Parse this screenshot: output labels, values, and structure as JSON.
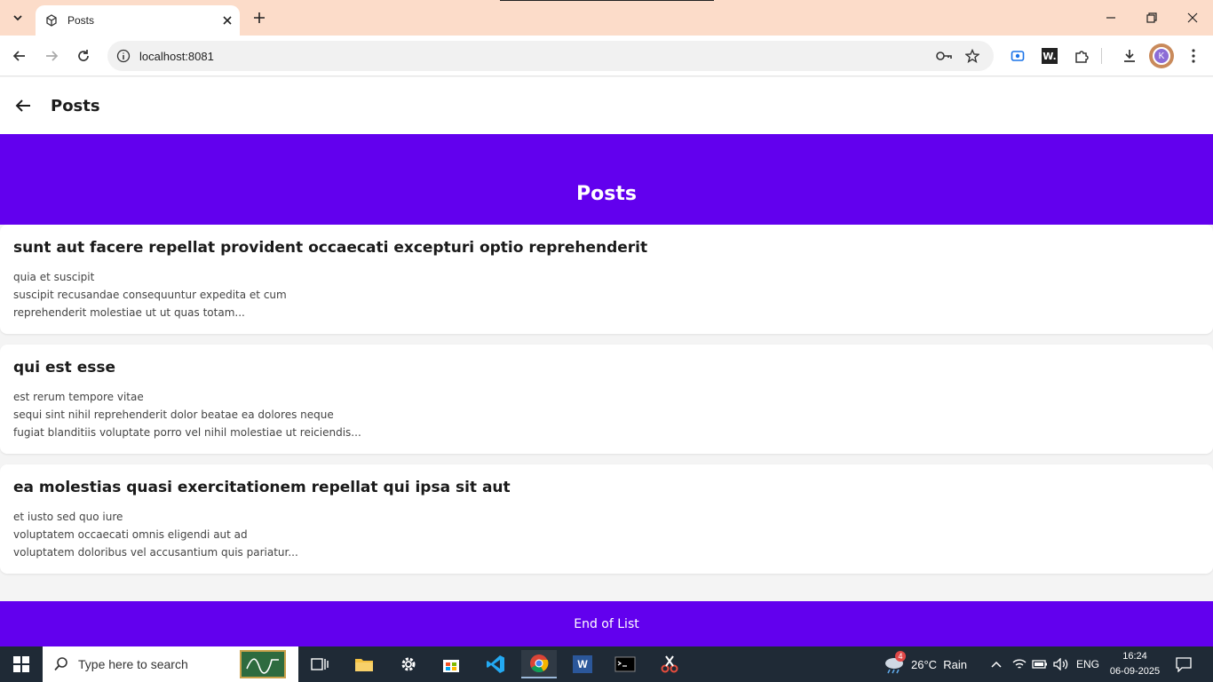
{
  "browser": {
    "tab_title": "Posts",
    "url": "localhost:8081",
    "avatar_letter": "K"
  },
  "app": {
    "header_title": "Posts",
    "hero_title": "Posts",
    "footer_text": "End of List",
    "accent_color": "#6200ee"
  },
  "posts": [
    {
      "title": "sunt aut facere repellat provident occaecati excepturi optio reprehenderit",
      "lines": [
        "quia et suscipit",
        "suscipit recusandae consequuntur expedita et cum",
        "reprehenderit molestiae ut ut quas totam..."
      ]
    },
    {
      "title": "qui est esse",
      "lines": [
        "est rerum tempore vitae",
        "sequi sint nihil reprehenderit dolor beatae ea dolores neque",
        "fugiat blanditiis voluptate porro vel nihil molestiae ut reiciendis..."
      ]
    },
    {
      "title": "ea molestias quasi exercitationem repellat qui ipsa sit aut",
      "lines": [
        "et iusto sed quo iure",
        "voluptatem occaecati omnis eligendi aut ad",
        "voluptatem doloribus vel accusantium quis pariatur..."
      ]
    }
  ],
  "taskbar": {
    "search_placeholder": "Type here to search",
    "weather": "26°C  Rain",
    "weather_badge": "4",
    "language": "ENG",
    "time": "16:24",
    "date": "06-09-2025"
  }
}
